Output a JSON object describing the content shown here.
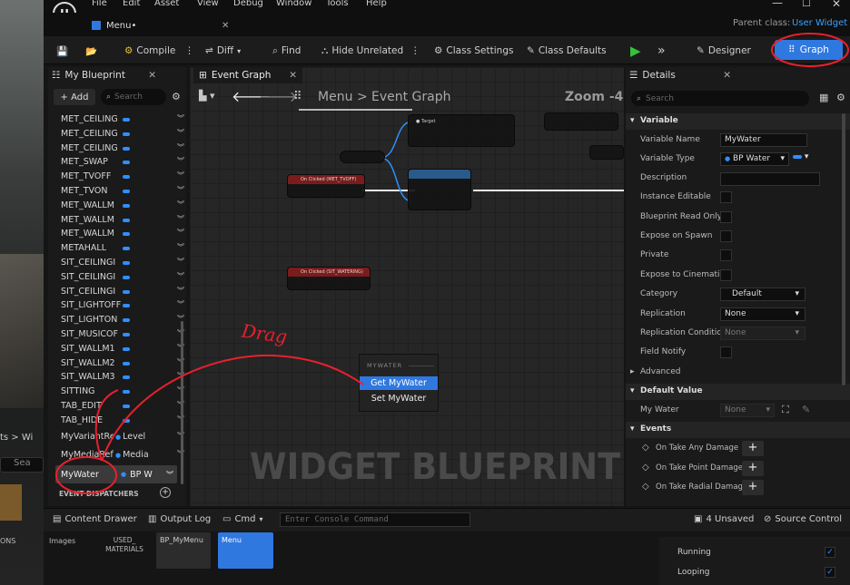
{
  "menu": [
    "File",
    "Edit",
    "Asset",
    "View",
    "Debug",
    "Window",
    "Tools",
    "Help"
  ],
  "window": {
    "tab_label": "Menu•",
    "parent_class_label": "Parent class:",
    "parent_class_value": "User Widget"
  },
  "toolbar": {
    "compile": "Compile",
    "diff": "Diff",
    "find": "Find",
    "hide_unrelated": "Hide Unrelated",
    "class_settings": "Class Settings",
    "class_defaults": "Class Defaults",
    "designer": "Designer",
    "graph": "Graph"
  },
  "my_blueprint": {
    "tab": "My Blueprint",
    "add": "+ Add",
    "search_placeholder": "Search",
    "variables": [
      "MET_CEILING",
      "MET_CEILING",
      "MET_CEILING",
      "MET_SWAP",
      "MET_TVOFF",
      "MET_TVON",
      "MET_WALLM",
      "MET_WALLM",
      "MET_WALLM",
      "METAHALL",
      "SIT_CEILINGI",
      "SIT_CEILINGI",
      "SIT_CEILINGI",
      "SIT_LIGHTOFF",
      "SIT_LIGHTON",
      "SIT_MUSICOF",
      "SIT_WALLM1",
      "SIT_WALLM2",
      "SIT_WALLM3",
      "SITTING",
      "TAB_EDIT",
      "TAB_HIDE"
    ],
    "variant_ref": {
      "name": "MyVariantRef",
      "type": "Level"
    },
    "media_ref": {
      "name": "MyMediaRef",
      "type": "Media"
    },
    "selected": {
      "name": "MyWater",
      "type": "BP W"
    },
    "event_dispatchers": "EVENT DISPATCHERS"
  },
  "event_graph": {
    "tab": "Event Graph",
    "breadcrumb_root": "Menu",
    "breadcrumb_sep": ">",
    "breadcrumb_leaf": "Event Graph",
    "zoom": "Zoom -4",
    "watermark": "WIDGET BLUEPRINT",
    "node_tvoff": "On Clicked (MET_TVOFF)",
    "node_watering": "On Clicked (SIT_WATERING)",
    "context_header": "MYWATER",
    "context_get": "Get MyWater",
    "context_set": "Set MyWater",
    "annotation": "Drag"
  },
  "details": {
    "tab": "Details",
    "search_placeholder": "Search",
    "variable_section": "Variable",
    "variable_name_label": "Variable Name",
    "variable_name_value": "MyWater",
    "variable_type_label": "Variable Type",
    "variable_type_value": "BP Water",
    "description_label": "Description",
    "instance_editable_label": "Instance Editable",
    "blueprint_read_only_label": "Blueprint Read Only",
    "expose_on_spawn_label": "Expose on Spawn",
    "private_label": "Private",
    "expose_cinematics_label": "Expose to Cinemati",
    "category_label": "Category",
    "category_value": "Default",
    "replication_label": "Replication",
    "replication_value": "None",
    "replication_condition_label": "Replication Conditio",
    "replication_condition_value": "None",
    "field_notify_label": "Field Notify",
    "advanced_label": "Advanced",
    "default_value_section": "Default Value",
    "my_water_label": "My Water",
    "my_water_value": "None",
    "events_section": "Events",
    "events": [
      "On Take Any Damage",
      "On Take Point Damage",
      "On Take Radial Damage"
    ]
  },
  "bottom": {
    "content_drawer": "Content Drawer",
    "output_log": "Output Log",
    "cmd": "Cmd",
    "console_placeholder": "Enter Console Command",
    "unsaved": "4 Unsaved",
    "source_control": "Source Control"
  },
  "content_browser": {
    "left_crumb": "ts > Wi",
    "search_label": "Sea",
    "ons": "ONS",
    "items": [
      "Images",
      "USED_ MATERIALS",
      "BP_MyMenu",
      "Menu"
    ]
  },
  "bottom_right": {
    "running": "Running",
    "looping": "Looping"
  },
  "colors": {
    "accent": "#2f8fff",
    "selected_tile": "#2f78e0",
    "annotation_red": "#e8202e",
    "play_green": "#34c23a"
  }
}
